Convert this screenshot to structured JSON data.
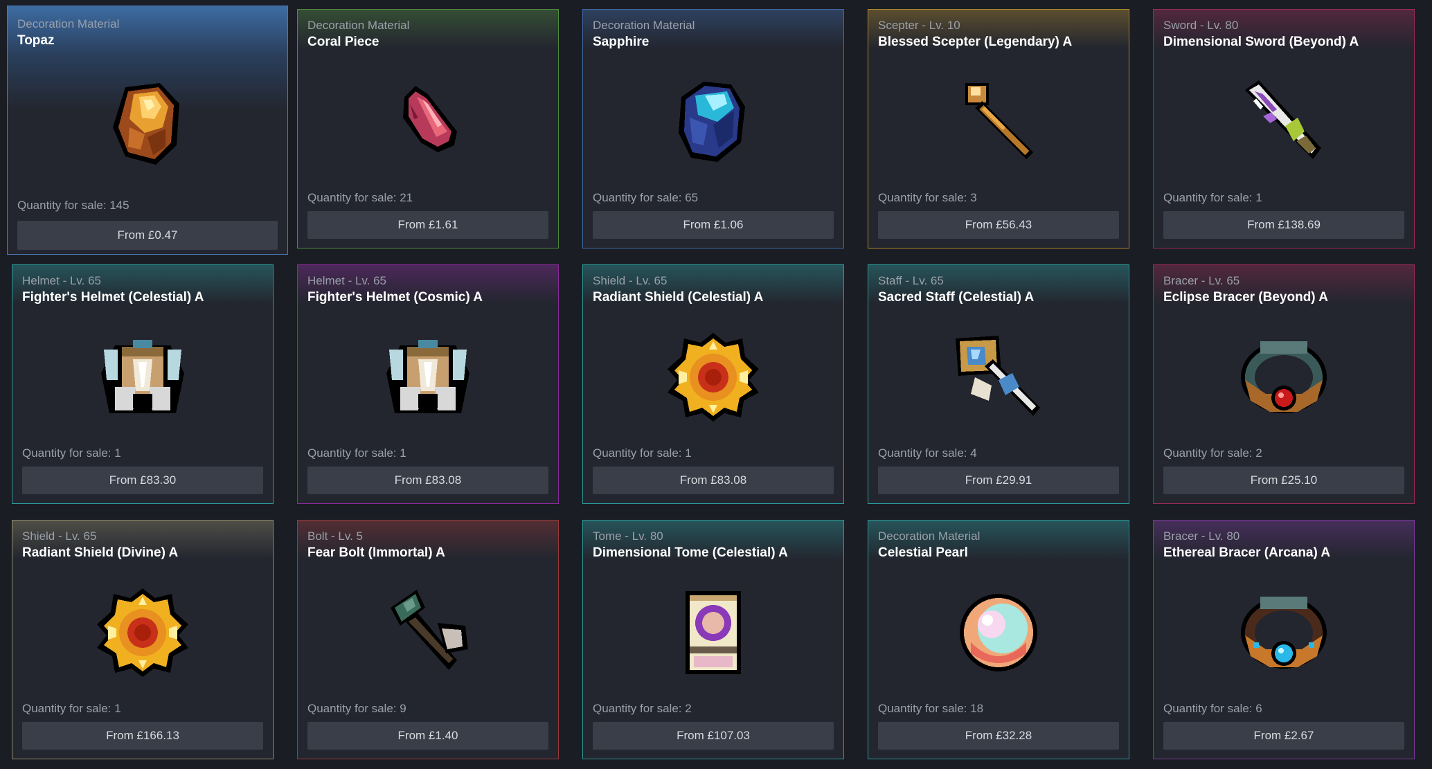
{
  "items": [
    {
      "category": "Decoration Material",
      "name": "Topaz",
      "quantity_text": "Quantity for sale: 145",
      "price_text": "From £0.47",
      "icon": "topaz-icon",
      "accent": "#4a79b6",
      "selected": true
    },
    {
      "category": "Decoration Material",
      "name": "Coral Piece",
      "quantity_text": "Quantity for sale: 21",
      "price_text": "From £1.61",
      "icon": "coral-icon",
      "accent": "#4f8a3c"
    },
    {
      "category": "Decoration Material",
      "name": "Sapphire",
      "quantity_text": "Quantity for sale: 65",
      "price_text": "From £1.06",
      "icon": "sapphire-icon",
      "accent": "#3e6aa8"
    },
    {
      "category": "Scepter - Lv. 10",
      "name": "Blessed Scepter (Legendary) A",
      "quantity_text": "Quantity for sale: 3",
      "price_text": "From £56.43",
      "icon": "scepter-icon",
      "accent": "#b08a2e"
    },
    {
      "category": "Sword - Lv. 80",
      "name": "Dimensional Sword (Beyond) A",
      "quantity_text": "Quantity for sale: 1",
      "price_text": "From £138.69",
      "icon": "sword-icon",
      "accent": "#9a2a55"
    },
    {
      "category": "Helmet - Lv. 65",
      "name": "Fighter's Helmet (Celestial) A",
      "quantity_text": "Quantity for sale: 1",
      "price_text": "From £83.30",
      "icon": "helmet-icon",
      "accent": "#2a9a9a"
    },
    {
      "category": "Helmet - Lv. 65",
      "name": "Fighter's Helmet (Cosmic) A",
      "quantity_text": "Quantity for sale: 1",
      "price_text": "From £83.08",
      "icon": "helmet-icon",
      "accent": "#8a2a9a"
    },
    {
      "category": "Shield - Lv. 65",
      "name": "Radiant Shield (Celestial) A",
      "quantity_text": "Quantity for sale: 1",
      "price_text": "From £83.08",
      "icon": "shield-icon",
      "accent": "#2a9a9a"
    },
    {
      "category": "Staff - Lv. 65",
      "name": "Sacred Staff (Celestial) A",
      "quantity_text": "Quantity for sale: 4",
      "price_text": "From £29.91",
      "icon": "staff-icon",
      "accent": "#2a9a9a"
    },
    {
      "category": "Bracer - Lv. 65",
      "name": "Eclipse Bracer (Beyond) A",
      "quantity_text": "Quantity for sale: 2",
      "price_text": "From £25.10",
      "icon": "bracer-red-icon",
      "accent": "#9a2a55"
    },
    {
      "category": "Shield - Lv. 65",
      "name": "Radiant Shield (Divine) A",
      "quantity_text": "Quantity for sale: 1",
      "price_text": "From £166.13",
      "icon": "shield-icon",
      "accent": "#8f8a6a"
    },
    {
      "category": "Bolt - Lv. 5",
      "name": "Fear Bolt (Immortal) A",
      "quantity_text": "Quantity for sale: 9",
      "price_text": "From £1.40",
      "icon": "bolt-icon",
      "accent": "#9a3a3a"
    },
    {
      "category": "Tome - Lv. 80",
      "name": "Dimensional Tome (Celestial) A",
      "quantity_text": "Quantity for sale: 2",
      "price_text": "From £107.03",
      "icon": "tome-icon",
      "accent": "#2a9a9a"
    },
    {
      "category": "Decoration Material",
      "name": "Celestial Pearl",
      "quantity_text": "Quantity for sale: 18",
      "price_text": "From £32.28",
      "icon": "pearl-icon",
      "accent": "#2a9a9a"
    },
    {
      "category": "Bracer - Lv. 80",
      "name": "Ethereal Bracer (Arcana) A",
      "quantity_text": "Quantity for sale: 6",
      "price_text": "From £2.67",
      "icon": "bracer-blue-icon",
      "accent": "#7a3a9a"
    }
  ]
}
